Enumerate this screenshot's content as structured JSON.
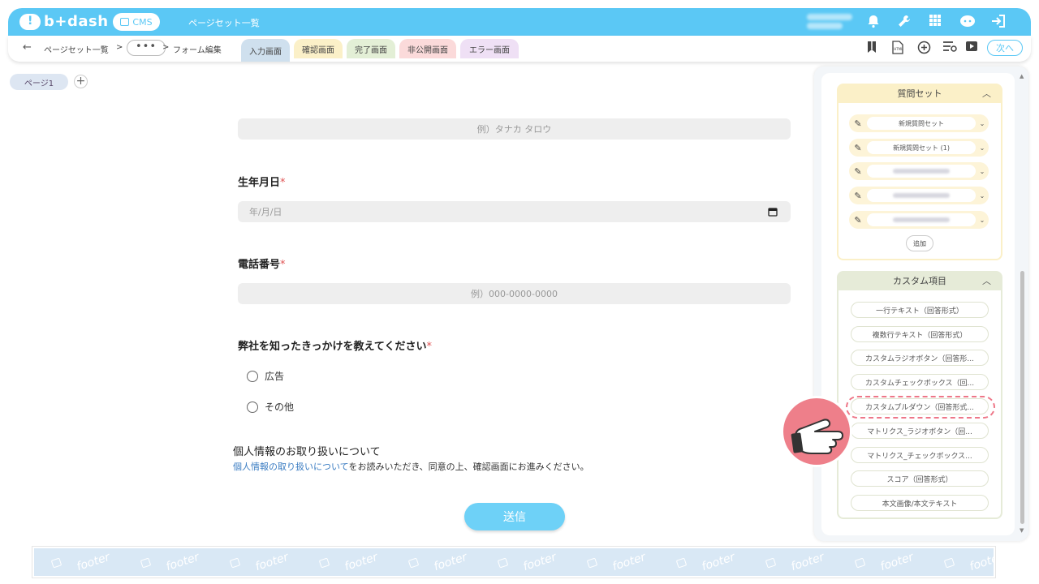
{
  "header": {
    "brand": "b+dash",
    "cms_label": "CMS",
    "title": "ページセット一覧",
    "icons": [
      "bell-icon",
      "wrench-icon",
      "grid-icon",
      "support-icon",
      "logout-icon"
    ]
  },
  "subbar": {
    "breadcrumb_1": "ページセット一覧",
    "breadcrumb_sep": ">",
    "breadcrumb_dots": "•••",
    "breadcrumb_3": "フォーム編集",
    "tabs": [
      {
        "label": "入力画面",
        "color": "#cfe0ee"
      },
      {
        "label": "確認画面",
        "color": "#fbf0c8"
      },
      {
        "label": "完了画面",
        "color": "#e3efd6"
      },
      {
        "label": "非公開画面",
        "color": "#fbdada"
      },
      {
        "label": "エラー画面",
        "color": "#efe0f5"
      }
    ],
    "right_icons": [
      "bookmark-icon",
      "html-file-icon",
      "add-circle-icon",
      "list-settings-icon",
      "play-icon"
    ],
    "next_label": "次へ"
  },
  "page_tab": {
    "label": "ページ1",
    "add": "+"
  },
  "form": {
    "name_placeholder": "例）タナカ タロウ",
    "birth_label": "生年月日",
    "birth_placeholder": "年/月/日",
    "phone_label": "電話番号",
    "phone_placeholder": "例）000-0000-0000",
    "source_label": "弊社を知ったきっかけを教えてください",
    "required_mark": "*",
    "options": [
      "広告",
      "その他"
    ],
    "privacy_title": "個人情報のお取り扱いについて",
    "privacy_link": "個人情報の取り扱いについて",
    "privacy_text": "をお読みいただき、同意の上、確認画面にお進みください。",
    "submit_label": "送信"
  },
  "footer": {
    "word": "footer"
  },
  "panel": {
    "qset_title": "質問セット",
    "qset_items": [
      "新規質問セット",
      "新規質問セット (1)"
    ],
    "add_label": "追加",
    "custom_title": "カスタム項目",
    "custom_items": [
      "一行テキスト（回答形式）",
      "複数行テキスト（回答形式）",
      "カスタムラジオボタン（回答形...",
      "カスタムチェックボックス（回...",
      "カスタムプルダウン（回答形式...",
      "マトリクス_ラジオボタン（回...",
      "マトリクス_チェックボックス...",
      "スコア（回答形式）",
      "本文画像/本文テキスト"
    ],
    "qset_color": "#fbf0c8",
    "custom_color": "#e6ebd8",
    "highlight_color": "#ee7788"
  }
}
